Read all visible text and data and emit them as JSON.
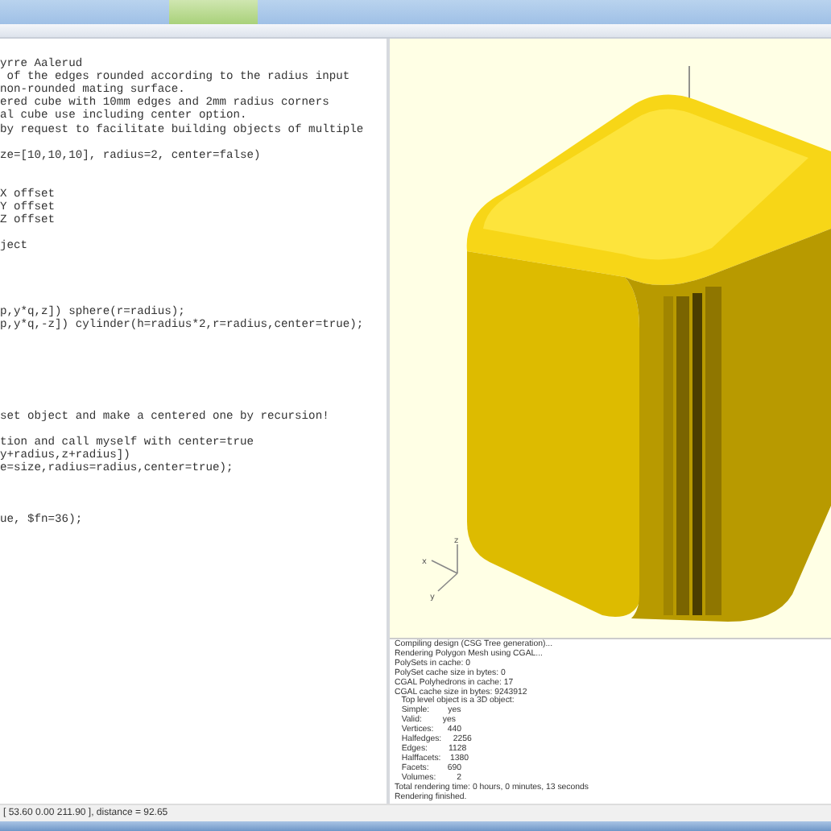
{
  "editor": {
    "code_blocks": [
      {
        "lines": [
          "yrre Aalerud",
          " of the edges rounded according to the radius input",
          "non-rounded mating surface.",
          "ered cube with 10mm edges and 2mm radius corners",
          "al cube use including center option.",
          "by request to facilitate building objects of multiple"
        ]
      },
      {
        "lines": [
          "ze=[10,10,10], radius=2, center=false)"
        ]
      },
      {
        "lines": [
          "X offset",
          "Y offset",
          "Z offset"
        ]
      },
      {
        "lines": [
          "ject"
        ]
      },
      {
        "lines": [
          "p,y*q,z]) sphere(r=radius);",
          "p,y*q,-z]) cylinder(h=radius*2,r=radius,center=true);"
        ]
      },
      {
        "lines": [
          "set object and make a centered one by recursion!"
        ]
      },
      {
        "lines": [
          "tion and call myself with center=true",
          "y+radius,z+radius])",
          "e=size,radius=radius,center=true);"
        ]
      },
      {
        "lines": [
          "ue, $fn=36);"
        ]
      }
    ]
  },
  "viewer": {
    "axes": [
      "x",
      "y",
      "z"
    ]
  },
  "console": {
    "lines": [
      "Compiling design (CSG Tree generation)...",
      "Rendering Polygon Mesh using CGAL...",
      "PolySets in cache: 0",
      "PolySet cache size in bytes: 0",
      "CGAL Polyhedrons in cache: 17",
      "CGAL cache size in bytes: 9243912",
      "   Top level object is a 3D object:",
      "   Simple:        yes",
      "   Valid:         yes",
      "   Vertices:      440",
      "   Halfedges:     2256",
      "   Edges:         1128",
      "   Halffacets:    1380",
      "   Facets:        690",
      "   Volumes:         2",
      "Total rendering time: 0 hours, 0 minutes, 13 seconds",
      "Rendering finished."
    ]
  },
  "status_bar": {
    "text": "[ 53.60 0.00 211.90 ], distance = 92.65"
  }
}
